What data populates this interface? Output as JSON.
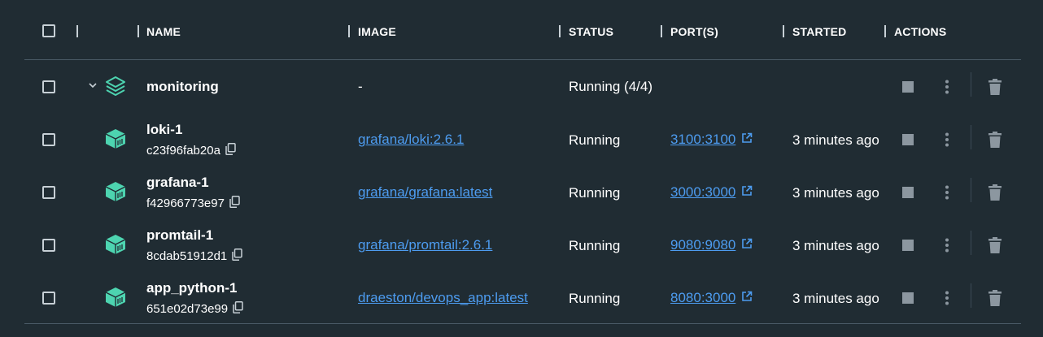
{
  "header": {
    "name": "NAME",
    "image": "IMAGE",
    "status": "STATUS",
    "ports": "PORT(S)",
    "started": "STARTED",
    "actions": "ACTIONS"
  },
  "group": {
    "name": "monitoring",
    "image": "-",
    "status": "Running (4/4)"
  },
  "containers": [
    {
      "name": "loki-1",
      "id": "c23f96fab20a",
      "image": "grafana/loki:2.6.1",
      "status": "Running",
      "ports": "3100:3100",
      "started": "3 minutes ago"
    },
    {
      "name": "grafana-1",
      "id": "f42966773e97",
      "image": "grafana/grafana:latest",
      "status": "Running",
      "ports": "3000:3000",
      "started": "3 minutes ago"
    },
    {
      "name": "promtail-1",
      "id": "8cdab51912d1",
      "image": "grafana/promtail:2.6.1",
      "status": "Running",
      "ports": "9080:9080",
      "started": "3 minutes ago"
    },
    {
      "name": "app_python-1",
      "id": "651e02d73e99",
      "image": "draeston/devops_app:latest",
      "status": "Running",
      "ports": "8080:3000",
      "started": "3 minutes ago"
    }
  ],
  "icons": {
    "group": "stack-layers-icon",
    "container": "container-cube-icon",
    "copy": "copy-icon",
    "external": "external-link-icon",
    "stop": "stop-icon",
    "more": "more-vertical-icon",
    "delete": "trash-icon"
  },
  "colors": {
    "background": "#202c33",
    "accent": "#4dd4b0",
    "link": "#4d9cf0",
    "icon": "#8c97a0"
  }
}
